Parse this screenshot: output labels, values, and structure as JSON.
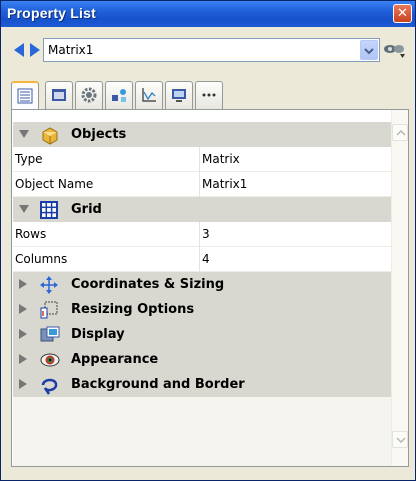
{
  "window": {
    "title": "Property List"
  },
  "selector": {
    "value": "Matrix1"
  },
  "tabs": [
    "general-tab",
    "display-tab",
    "settings-tab",
    "shapes-tab",
    "chart-tab",
    "monitor-tab",
    "more-tab"
  ],
  "colors": {
    "title_bar": "#1f5fd8",
    "category_bg": "#d9d8d0",
    "close_button": "#d15a36",
    "active_tab_accent": "#f5b43c"
  },
  "categories": {
    "objects": {
      "label": "Objects",
      "expanded": true,
      "icon": "cube-icon"
    },
    "grid": {
      "label": "Grid",
      "expanded": true,
      "icon": "grid-icon"
    },
    "coordinates": {
      "label": "Coordinates & Sizing",
      "expanded": false,
      "icon": "move-arrows-icon"
    },
    "resizing": {
      "label": "Resizing Options",
      "expanded": false,
      "icon": "resize-icon"
    },
    "display": {
      "label": "Display",
      "expanded": false,
      "icon": "display-icon"
    },
    "appearance": {
      "label": "Appearance",
      "expanded": false,
      "icon": "eye-icon"
    },
    "background": {
      "label": "Background and Border",
      "expanded": false,
      "icon": "lasso-icon"
    }
  },
  "properties": {
    "type": {
      "name": "Type",
      "value": "Matrix"
    },
    "object_name": {
      "name": "Object Name",
      "value": "Matrix1"
    },
    "rows": {
      "name": "Rows",
      "value": "3"
    },
    "columns": {
      "name": "Columns",
      "value": "4"
    }
  }
}
